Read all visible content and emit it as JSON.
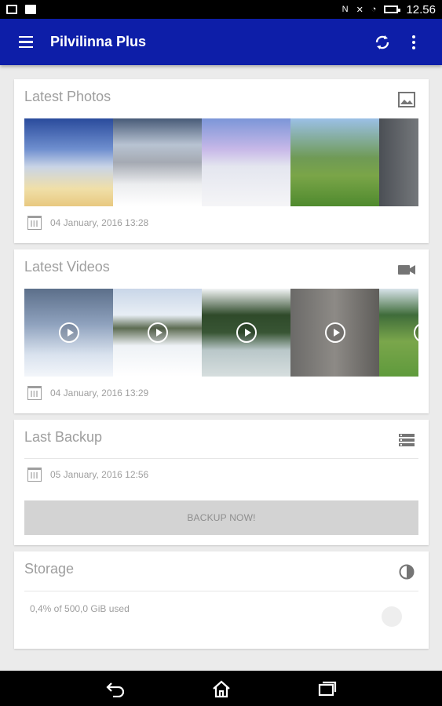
{
  "status_bar": {
    "time": "12.56"
  },
  "app_bar": {
    "title": "Pilvilinna Plus"
  },
  "colors": {
    "app_bar": "#0d1ea8",
    "background": "#ebebeb",
    "card": "#ffffff",
    "muted_text": "#9e9e9e",
    "button": "#d3d3d3"
  },
  "cards": {
    "photos": {
      "title": "Latest Photos",
      "icon": "image-icon",
      "date": "04 January, 2016 13:28"
    },
    "videos": {
      "title": "Latest Videos",
      "icon": "videocam-icon",
      "date": "04 January, 2016 13:29"
    },
    "backup": {
      "title": "Last Backup",
      "icon": "list-icon",
      "date": "05 January, 2016 12:56",
      "button_label": "BACKUP NOW!"
    },
    "storage": {
      "title": "Storage",
      "icon": "pie-chart-icon",
      "usage": "0,4% of 500,0 GiB used",
      "used_percent": 0.4
    }
  },
  "nav_bar": {
    "items": [
      "back-icon",
      "home-icon",
      "recents-icon"
    ]
  }
}
